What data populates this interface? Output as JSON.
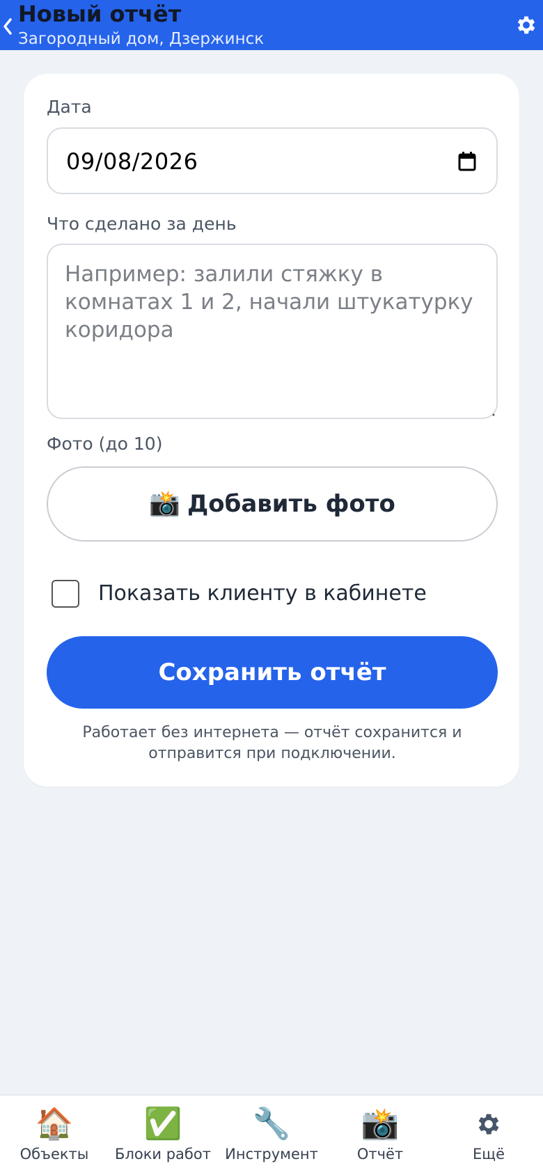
{
  "header": {
    "title": "Новый отчёт",
    "subtitle": "Загородный дом, Дзержинск",
    "back_icon": "chevron-left-icon",
    "settings_icon": "gear-icon"
  },
  "form": {
    "date_label": "Дата",
    "date_value": "09/08/2026",
    "done_label": "Что сделано за день",
    "done_placeholder": "Например: залили стяжку в комнатах 1 и 2, начали штукатурку коридора",
    "photo_label": "Фото (до 10)",
    "photo_button_emoji": "📸",
    "photo_button_label": "Добавить фото",
    "show_client_label": "Показать клиенту в кабинете",
    "show_client_checked": false,
    "save_button_label": "Сохранить отчёт",
    "offline_note": "Работает без интернета — отчёт сохранится и отправится при подключении."
  },
  "tabs": [
    {
      "label": "Объекты",
      "icon": "🏠",
      "icon_name": "house-icon"
    },
    {
      "label": "Блоки работ",
      "icon": "✅",
      "icon_name": "check-icon"
    },
    {
      "label": "Инструмент",
      "icon": "🔧",
      "icon_name": "wrench-icon"
    },
    {
      "label": "Отчёт",
      "icon": "📸",
      "icon_name": "camera-icon"
    },
    {
      "label": "Ещё",
      "icon": "⚙",
      "icon_name": "gear-icon"
    }
  ],
  "colors": {
    "accent": "#2563eb",
    "background": "#eff3f8"
  }
}
